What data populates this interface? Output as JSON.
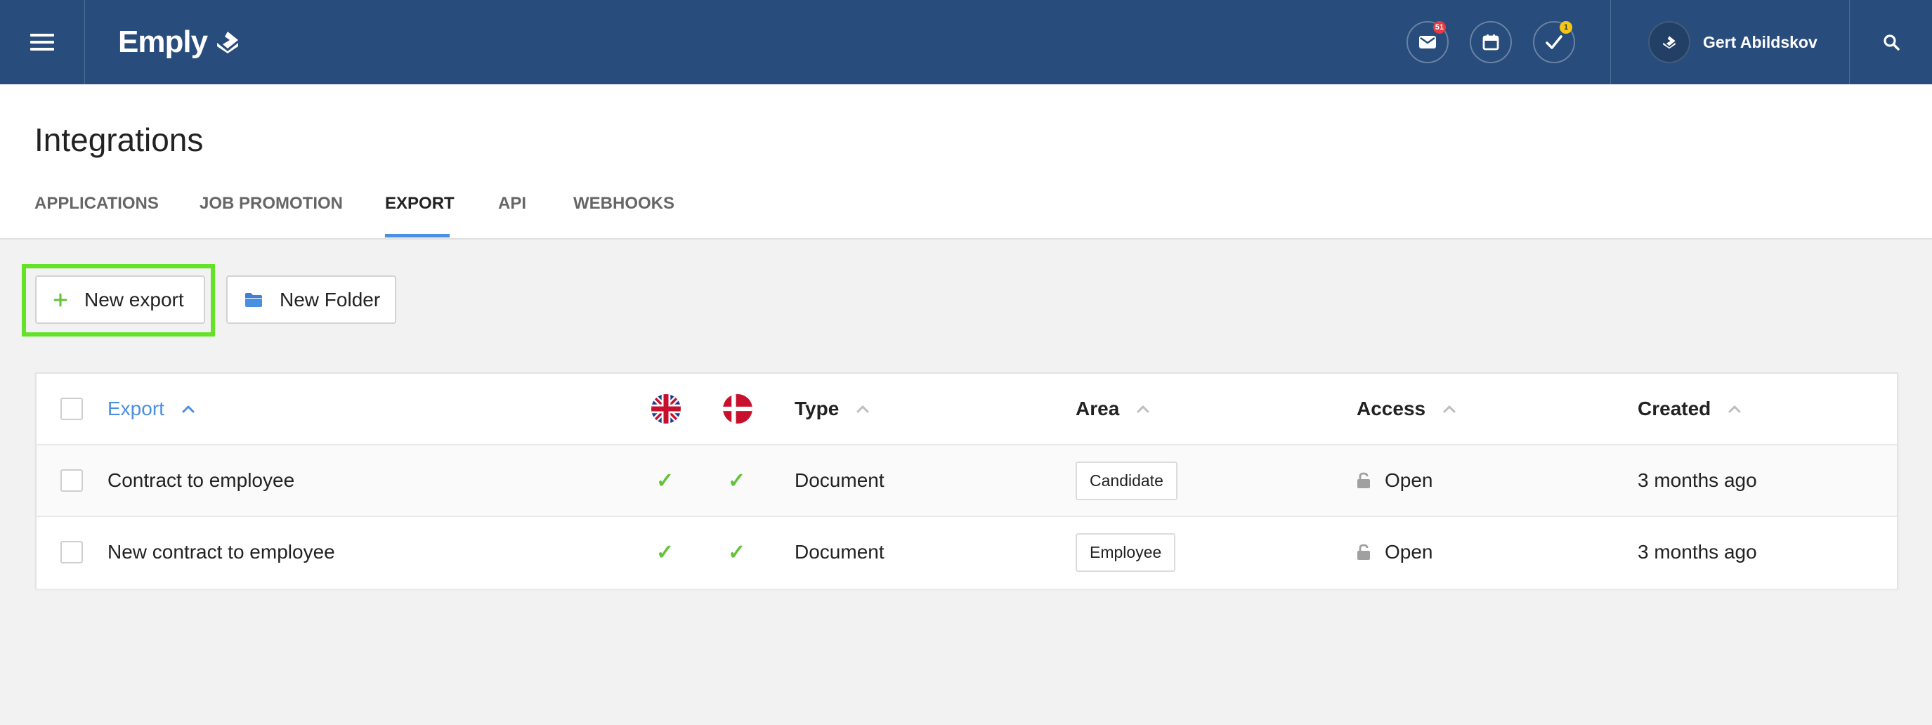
{
  "app": {
    "logo_text": "Emply",
    "brand_color": "#284c7b",
    "accent_color": "#4a8fe0",
    "highlight_color": "#63e227"
  },
  "topbar": {
    "mail_badge": "51",
    "tasks_badge": "1",
    "user_name": "Gert Abildskov"
  },
  "page": {
    "title": "Integrations",
    "tabs": [
      {
        "label": "APPLICATIONS",
        "active": false
      },
      {
        "label": "JOB PROMOTION",
        "active": false
      },
      {
        "label": "EXPORT",
        "active": true
      },
      {
        "label": "API",
        "active": false
      },
      {
        "label": "WEBHOOKS",
        "active": false
      }
    ]
  },
  "toolbar": {
    "new_export_label": "New export",
    "new_folder_label": "New Folder"
  },
  "table": {
    "columns": {
      "export": "Export",
      "type": "Type",
      "area": "Area",
      "access": "Access",
      "created": "Created"
    },
    "rows": [
      {
        "name": "Contract to employee",
        "en": "✓",
        "da": "✓",
        "type": "Document",
        "area": "Candidate",
        "access": "Open",
        "created": "3 months ago"
      },
      {
        "name": "New contract to employee",
        "en": "✓",
        "da": "✓",
        "type": "Document",
        "area": "Employee",
        "access": "Open",
        "created": "3 months ago"
      }
    ]
  }
}
